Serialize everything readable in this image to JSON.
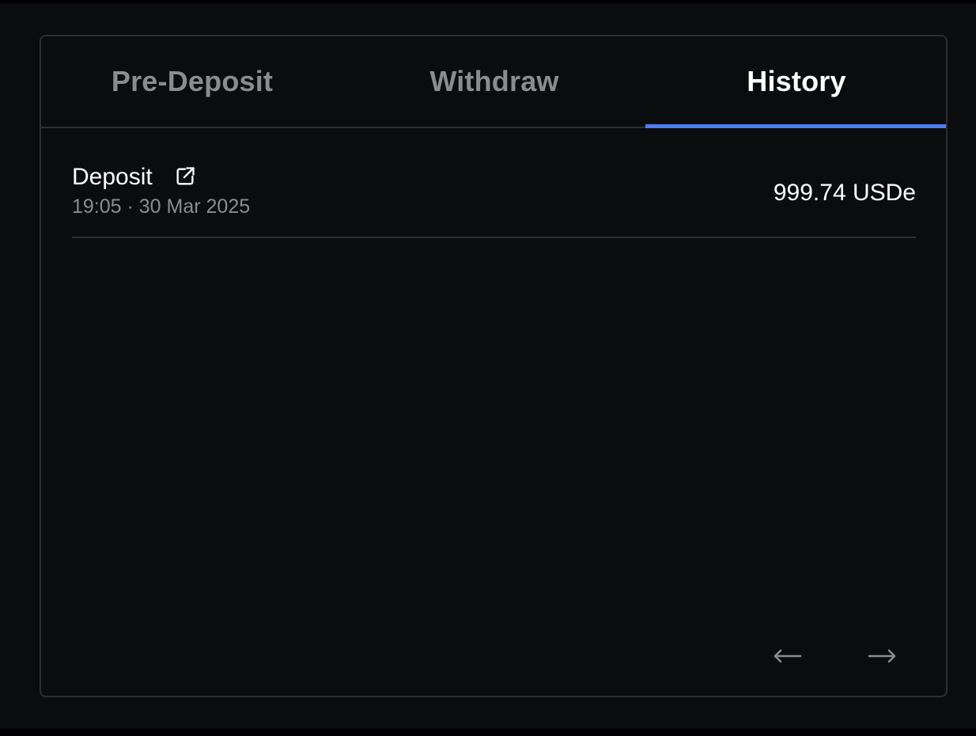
{
  "tabs": [
    {
      "label": "Pre-Deposit",
      "active": false
    },
    {
      "label": "Withdraw",
      "active": false
    },
    {
      "label": "History",
      "active": true
    }
  ],
  "history": {
    "rows": [
      {
        "type": "Deposit",
        "timestamp": "19:05 · 30 Mar 2025",
        "amount": "999.74 USDe",
        "link_icon": "external-link-icon"
      }
    ]
  },
  "pagination": {
    "prev_icon": "arrow-left-icon",
    "next_icon": "arrow-right-icon"
  },
  "colors": {
    "accent": "#4f7df1",
    "background": "#0b0c0e",
    "border": "#2b2d31",
    "muted_text": "#8a8c90"
  }
}
